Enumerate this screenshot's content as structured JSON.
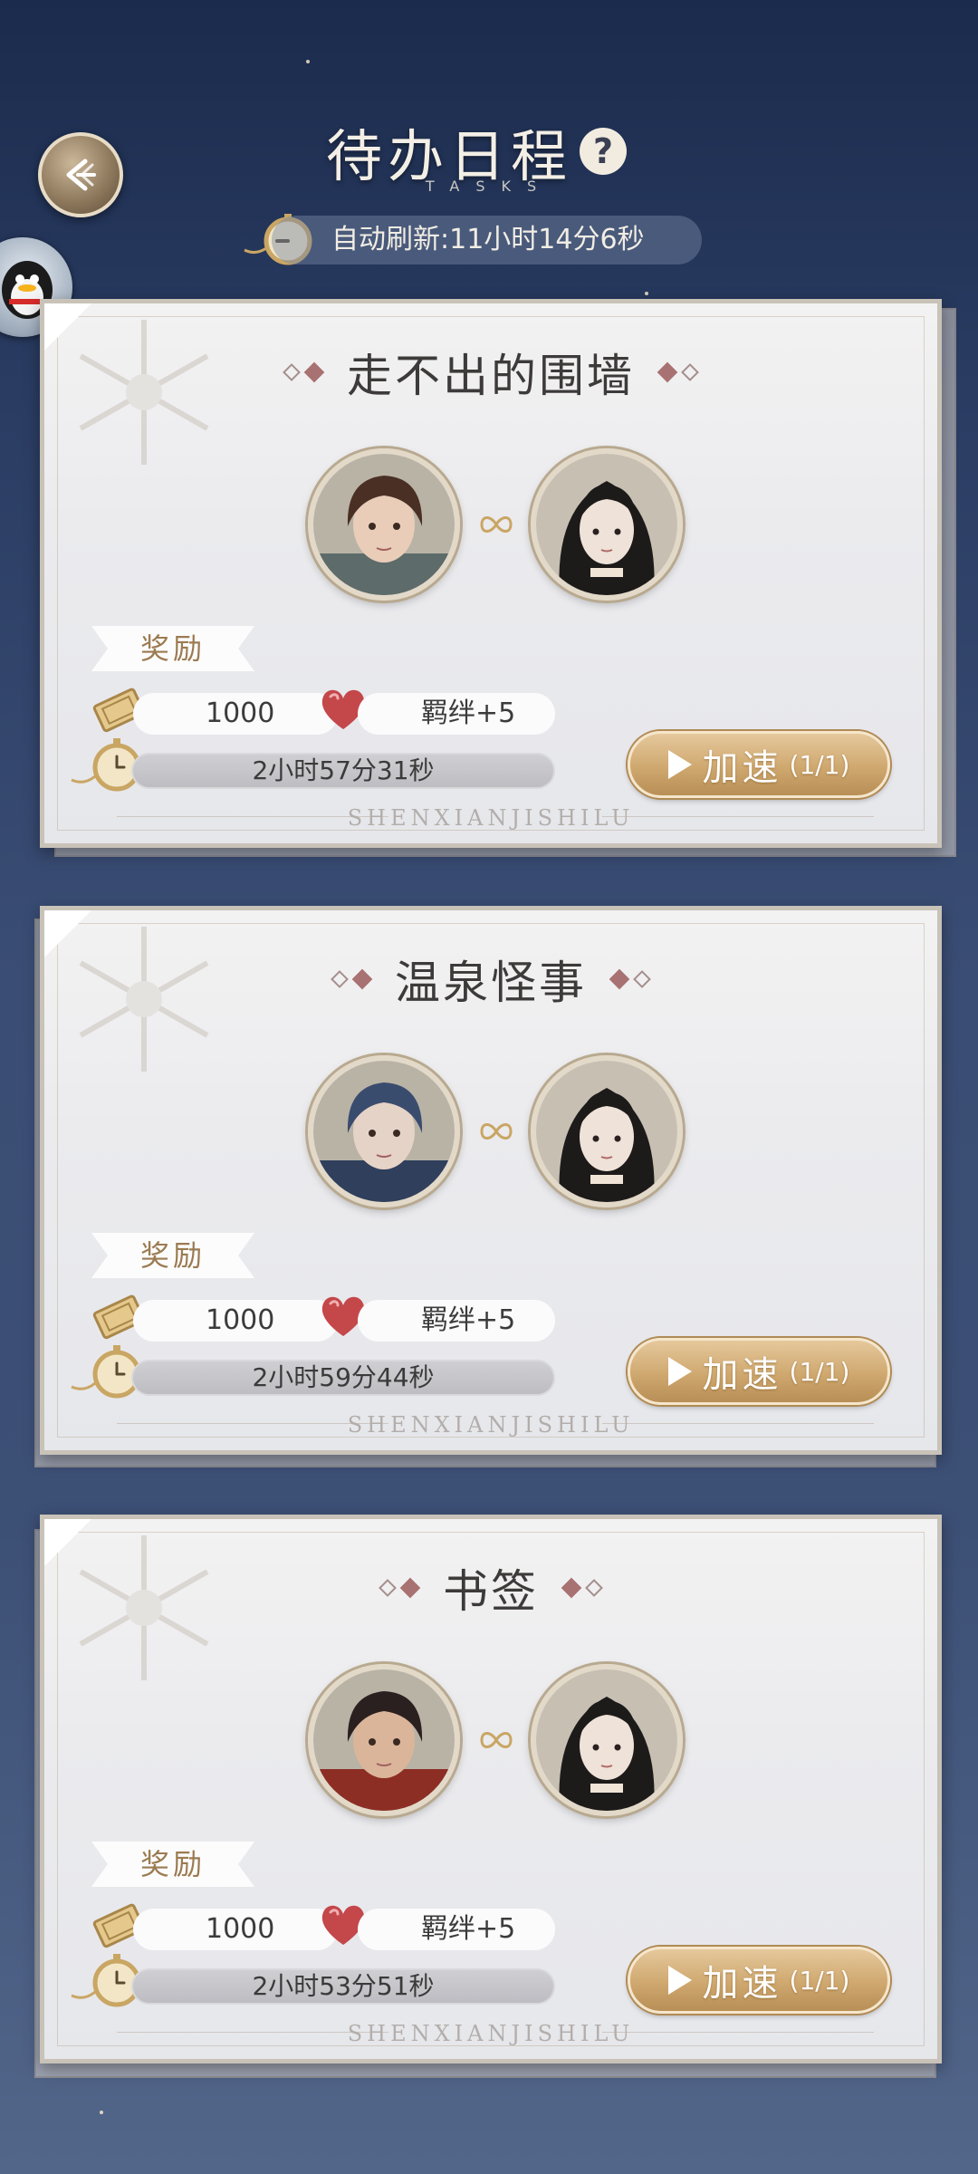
{
  "header": {
    "title": "待办日程",
    "subtitle": "TASKS",
    "help_label": "?",
    "refresh_text": "自动刷新:11小时14分6秒"
  },
  "icons": {
    "back": "back-arrow-icon",
    "help": "question-icon",
    "refresh": "pocket-watch-icon",
    "qq": "qq-penguin-icon",
    "reward_currency": "gold-ticket-icon",
    "reward_bond": "heart-icon",
    "link": "infinity-link-icon",
    "timer": "pocket-watch-icon"
  },
  "colors": {
    "accent_gold": "#cfa86f",
    "heart_red": "#b83a3a",
    "diamond_rose": "#a87172",
    "background_navy": "#2a3c62"
  },
  "tasks": [
    {
      "title": "走不出的围墙",
      "reward_label": "奖励",
      "currency_amount": "1000",
      "bond_text": "羁绊+5",
      "timer_text": "2小时57分31秒",
      "speedup_label": "加速",
      "speedup_count": "(1/1)",
      "footer": "SHENXIANJISHILU"
    },
    {
      "title": "温泉怪事",
      "reward_label": "奖励",
      "currency_amount": "1000",
      "bond_text": "羁绊+5",
      "timer_text": "2小时59分44秒",
      "speedup_label": "加速",
      "speedup_count": "(1/1)",
      "footer": "SHENXIANJISHILU"
    },
    {
      "title": "书签",
      "reward_label": "奖励",
      "currency_amount": "1000",
      "bond_text": "羁绊+5",
      "timer_text": "2小时53分51秒",
      "speedup_label": "加速",
      "speedup_count": "(1/1)",
      "footer": "SHENXIANJISHILU"
    }
  ]
}
